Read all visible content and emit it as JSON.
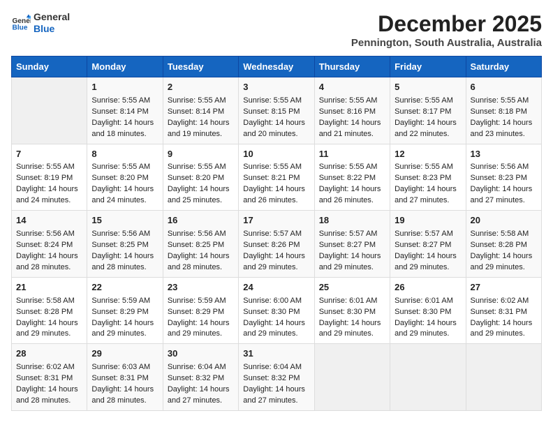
{
  "logo": {
    "line1": "General",
    "line2": "Blue"
  },
  "title": "December 2025",
  "subtitle": "Pennington, South Australia, Australia",
  "days_header": [
    "Sunday",
    "Monday",
    "Tuesday",
    "Wednesday",
    "Thursday",
    "Friday",
    "Saturday"
  ],
  "weeks": [
    [
      {
        "day": "",
        "data": ""
      },
      {
        "day": "1",
        "sunrise": "Sunrise: 5:55 AM",
        "sunset": "Sunset: 8:14 PM",
        "daylight": "Daylight: 14 hours and 18 minutes."
      },
      {
        "day": "2",
        "sunrise": "Sunrise: 5:55 AM",
        "sunset": "Sunset: 8:14 PM",
        "daylight": "Daylight: 14 hours and 19 minutes."
      },
      {
        "day": "3",
        "sunrise": "Sunrise: 5:55 AM",
        "sunset": "Sunset: 8:15 PM",
        "daylight": "Daylight: 14 hours and 20 minutes."
      },
      {
        "day": "4",
        "sunrise": "Sunrise: 5:55 AM",
        "sunset": "Sunset: 8:16 PM",
        "daylight": "Daylight: 14 hours and 21 minutes."
      },
      {
        "day": "5",
        "sunrise": "Sunrise: 5:55 AM",
        "sunset": "Sunset: 8:17 PM",
        "daylight": "Daylight: 14 hours and 22 minutes."
      },
      {
        "day": "6",
        "sunrise": "Sunrise: 5:55 AM",
        "sunset": "Sunset: 8:18 PM",
        "daylight": "Daylight: 14 hours and 23 minutes."
      }
    ],
    [
      {
        "day": "7",
        "sunrise": "Sunrise: 5:55 AM",
        "sunset": "Sunset: 8:19 PM",
        "daylight": "Daylight: 14 hours and 24 minutes."
      },
      {
        "day": "8",
        "sunrise": "Sunrise: 5:55 AM",
        "sunset": "Sunset: 8:20 PM",
        "daylight": "Daylight: 14 hours and 24 minutes."
      },
      {
        "day": "9",
        "sunrise": "Sunrise: 5:55 AM",
        "sunset": "Sunset: 8:20 PM",
        "daylight": "Daylight: 14 hours and 25 minutes."
      },
      {
        "day": "10",
        "sunrise": "Sunrise: 5:55 AM",
        "sunset": "Sunset: 8:21 PM",
        "daylight": "Daylight: 14 hours and 26 minutes."
      },
      {
        "day": "11",
        "sunrise": "Sunrise: 5:55 AM",
        "sunset": "Sunset: 8:22 PM",
        "daylight": "Daylight: 14 hours and 26 minutes."
      },
      {
        "day": "12",
        "sunrise": "Sunrise: 5:55 AM",
        "sunset": "Sunset: 8:23 PM",
        "daylight": "Daylight: 14 hours and 27 minutes."
      },
      {
        "day": "13",
        "sunrise": "Sunrise: 5:56 AM",
        "sunset": "Sunset: 8:23 PM",
        "daylight": "Daylight: 14 hours and 27 minutes."
      }
    ],
    [
      {
        "day": "14",
        "sunrise": "Sunrise: 5:56 AM",
        "sunset": "Sunset: 8:24 PM",
        "daylight": "Daylight: 14 hours and 28 minutes."
      },
      {
        "day": "15",
        "sunrise": "Sunrise: 5:56 AM",
        "sunset": "Sunset: 8:25 PM",
        "daylight": "Daylight: 14 hours and 28 minutes."
      },
      {
        "day": "16",
        "sunrise": "Sunrise: 5:56 AM",
        "sunset": "Sunset: 8:25 PM",
        "daylight": "Daylight: 14 hours and 28 minutes."
      },
      {
        "day": "17",
        "sunrise": "Sunrise: 5:57 AM",
        "sunset": "Sunset: 8:26 PM",
        "daylight": "Daylight: 14 hours and 29 minutes."
      },
      {
        "day": "18",
        "sunrise": "Sunrise: 5:57 AM",
        "sunset": "Sunset: 8:27 PM",
        "daylight": "Daylight: 14 hours and 29 minutes."
      },
      {
        "day": "19",
        "sunrise": "Sunrise: 5:57 AM",
        "sunset": "Sunset: 8:27 PM",
        "daylight": "Daylight: 14 hours and 29 minutes."
      },
      {
        "day": "20",
        "sunrise": "Sunrise: 5:58 AM",
        "sunset": "Sunset: 8:28 PM",
        "daylight": "Daylight: 14 hours and 29 minutes."
      }
    ],
    [
      {
        "day": "21",
        "sunrise": "Sunrise: 5:58 AM",
        "sunset": "Sunset: 8:28 PM",
        "daylight": "Daylight: 14 hours and 29 minutes."
      },
      {
        "day": "22",
        "sunrise": "Sunrise: 5:59 AM",
        "sunset": "Sunset: 8:29 PM",
        "daylight": "Daylight: 14 hours and 29 minutes."
      },
      {
        "day": "23",
        "sunrise": "Sunrise: 5:59 AM",
        "sunset": "Sunset: 8:29 PM",
        "daylight": "Daylight: 14 hours and 29 minutes."
      },
      {
        "day": "24",
        "sunrise": "Sunrise: 6:00 AM",
        "sunset": "Sunset: 8:30 PM",
        "daylight": "Daylight: 14 hours and 29 minutes."
      },
      {
        "day": "25",
        "sunrise": "Sunrise: 6:01 AM",
        "sunset": "Sunset: 8:30 PM",
        "daylight": "Daylight: 14 hours and 29 minutes."
      },
      {
        "day": "26",
        "sunrise": "Sunrise: 6:01 AM",
        "sunset": "Sunset: 8:30 PM",
        "daylight": "Daylight: 14 hours and 29 minutes."
      },
      {
        "day": "27",
        "sunrise": "Sunrise: 6:02 AM",
        "sunset": "Sunset: 8:31 PM",
        "daylight": "Daylight: 14 hours and 29 minutes."
      }
    ],
    [
      {
        "day": "28",
        "sunrise": "Sunrise: 6:02 AM",
        "sunset": "Sunset: 8:31 PM",
        "daylight": "Daylight: 14 hours and 28 minutes."
      },
      {
        "day": "29",
        "sunrise": "Sunrise: 6:03 AM",
        "sunset": "Sunset: 8:31 PM",
        "daylight": "Daylight: 14 hours and 28 minutes."
      },
      {
        "day": "30",
        "sunrise": "Sunrise: 6:04 AM",
        "sunset": "Sunset: 8:32 PM",
        "daylight": "Daylight: 14 hours and 27 minutes."
      },
      {
        "day": "31",
        "sunrise": "Sunrise: 6:04 AM",
        "sunset": "Sunset: 8:32 PM",
        "daylight": "Daylight: 14 hours and 27 minutes."
      },
      {
        "day": "",
        "data": ""
      },
      {
        "day": "",
        "data": ""
      },
      {
        "day": "",
        "data": ""
      }
    ]
  ]
}
